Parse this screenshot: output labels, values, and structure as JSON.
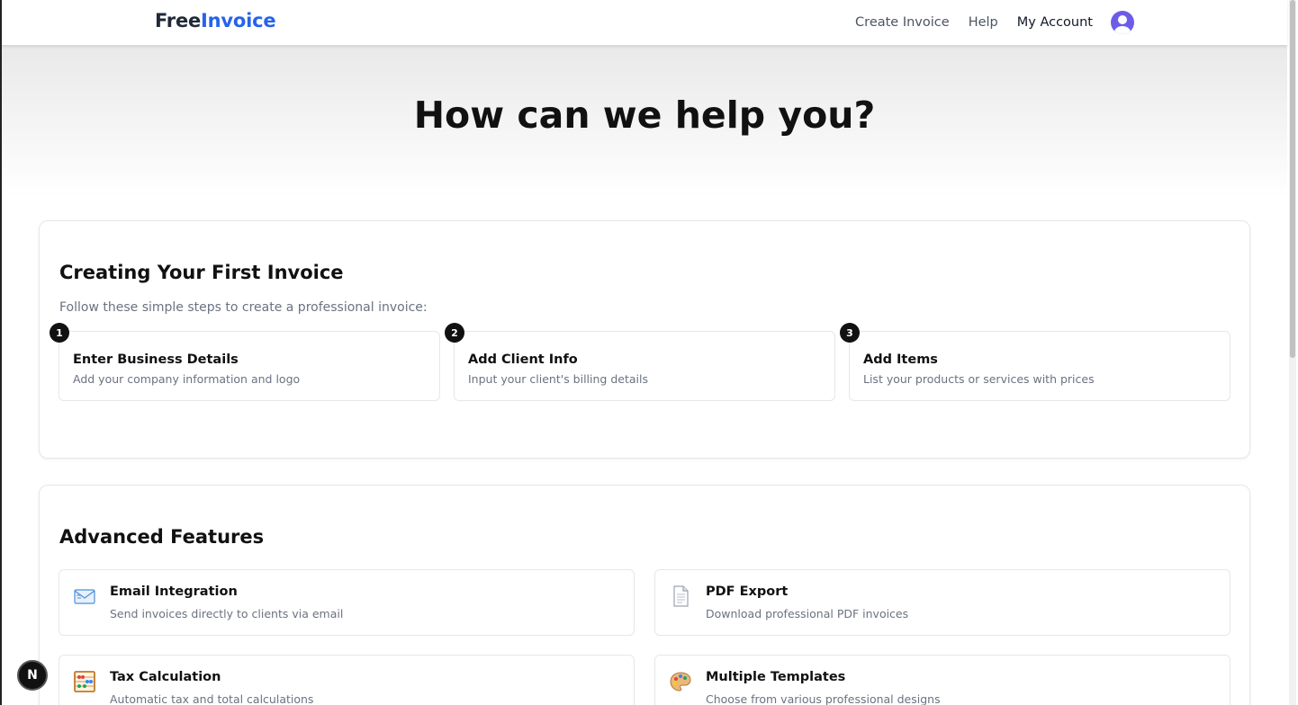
{
  "header": {
    "logo_part1": "Free",
    "logo_part2": "Invoice",
    "nav": [
      "Create Invoice",
      "Help",
      "My Account"
    ],
    "avatar_icon": "user-avatar-icon"
  },
  "hero": {
    "title": "How can we help you?"
  },
  "first_invoice": {
    "title": "Creating Your First Invoice",
    "subtitle": "Follow these simple steps to create a professional invoice:",
    "steps": [
      {
        "num": "1",
        "title": "Enter Business Details",
        "desc": "Add your company information and logo"
      },
      {
        "num": "2",
        "title": "Add Client Info",
        "desc": "Input your client's billing details"
      },
      {
        "num": "3",
        "title": "Add Items",
        "desc": "List your products or services with prices"
      }
    ]
  },
  "advanced": {
    "title": "Advanced Features",
    "features": [
      {
        "icon": "email-icon",
        "glyph": "📧",
        "title": "Email Integration",
        "desc": "Send invoices directly to clients via email"
      },
      {
        "icon": "document-icon",
        "glyph": "📄",
        "title": "PDF Export",
        "desc": "Download professional PDF invoices"
      },
      {
        "icon": "abacus-icon",
        "glyph": "🧮",
        "title": "Tax Calculation",
        "desc": "Automatic tax and total calculations"
      },
      {
        "icon": "palette-icon",
        "glyph": "🎨",
        "title": "Multiple Templates",
        "desc": "Choose from various professional designs"
      }
    ]
  },
  "devtool": {
    "label": "N"
  },
  "colors": {
    "brand_blue": "#2563eb",
    "avatar": "#6d5ce8"
  }
}
